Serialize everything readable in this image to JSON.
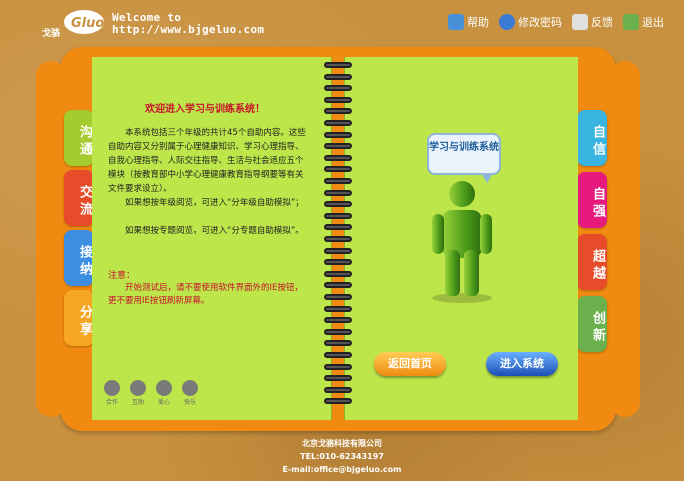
{
  "header": {
    "logo_text": "戈骆",
    "welcome_line1": "Welcome to",
    "welcome_line2": "http://www.bjgeluo.com"
  },
  "topnav": [
    {
      "label": "帮助",
      "icon": "help-icon",
      "color": "#4a90d9"
    },
    {
      "label": "修改密码",
      "icon": "user-icon",
      "color": "#3a7bd5"
    },
    {
      "label": "反馈",
      "icon": "feedback-icon",
      "color": "#e0e0e0"
    },
    {
      "label": "退出",
      "icon": "exit-icon",
      "color": "#6ab04c"
    }
  ],
  "left_tabs": [
    {
      "label": "沟通",
      "color": "#a4cc2e"
    },
    {
      "label": "交流",
      "color": "#e84b2a"
    },
    {
      "label": "接纳",
      "color": "#3d8ee0"
    },
    {
      "label": "分享",
      "color": "#f6a623"
    }
  ],
  "right_tabs": [
    {
      "label": "自信",
      "color": "#3ab4e0"
    },
    {
      "label": "自强",
      "color": "#e6197d"
    },
    {
      "label": "超越",
      "color": "#e84b2a"
    },
    {
      "label": "创新",
      "color": "#6ab04c"
    }
  ],
  "content": {
    "title": "欢迎进入学习与训练系统！",
    "para1": "本系统包括三个年级的共计45个自助内容。这些自助内容又分别属于心理健康知识、学习心理指导、自我心理指导、人际交往指导、生活与社会适应五个模块（按教育部中小学心理健康教育指导纲要等有关文件要求设立）。",
    "para2": "如果想按年级阅览，可进入“分年级自助模拟”；",
    "para3": "如果想按专题阅览，可进入“分专题自助模拟”。",
    "note_head": "注意：",
    "note": "开始测试后，请不要使用软件界面外的IE按钮，更不要用IE按钮刷新屏幕。"
  },
  "figures": [
    "合作",
    "互助",
    "爱心",
    "快乐"
  ],
  "bubble": "学习与训练系统",
  "buttons": {
    "home": "返回首页",
    "enter": "进入系统"
  },
  "footer": {
    "company": "北京戈骆科技有限公司",
    "tel": "TEL:010-62343197",
    "email": "E-mail:office@bjgeluo.com"
  }
}
